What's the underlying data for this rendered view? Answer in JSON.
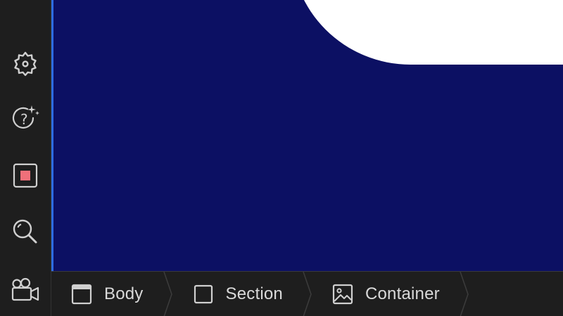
{
  "left_rail": {
    "items": [
      {
        "icon": "gear-icon"
      },
      {
        "icon": "help-ai-icon"
      },
      {
        "icon": "stop-record-icon",
        "accent": "#f0707a"
      },
      {
        "icon": "search-icon"
      },
      {
        "icon": "video-camera-icon"
      }
    ]
  },
  "canvas": {
    "background": "#0c1063",
    "selection_color": "#2e6ce0"
  },
  "breadcrumb": {
    "items": [
      {
        "label": "Body",
        "icon": "window-icon"
      },
      {
        "label": "Section",
        "icon": "square-icon"
      },
      {
        "label": "Container",
        "icon": "image-icon"
      }
    ]
  }
}
